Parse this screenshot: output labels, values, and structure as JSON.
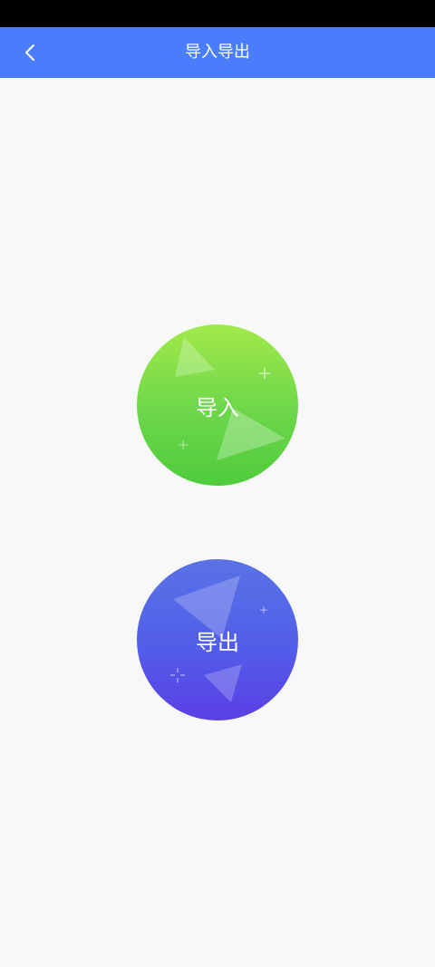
{
  "header": {
    "title": "导入导出",
    "back_icon": "chevron-left-icon"
  },
  "actions": {
    "import_label": "导入",
    "export_label": "导出"
  },
  "colors": {
    "nav_bar": "#4a7dfc",
    "import_gradient": [
      "#a2ea4a",
      "#4fcc3c"
    ],
    "export_gradient": [
      "#5a72e6",
      "#5a40e6"
    ],
    "background": "#f8f8f8"
  }
}
